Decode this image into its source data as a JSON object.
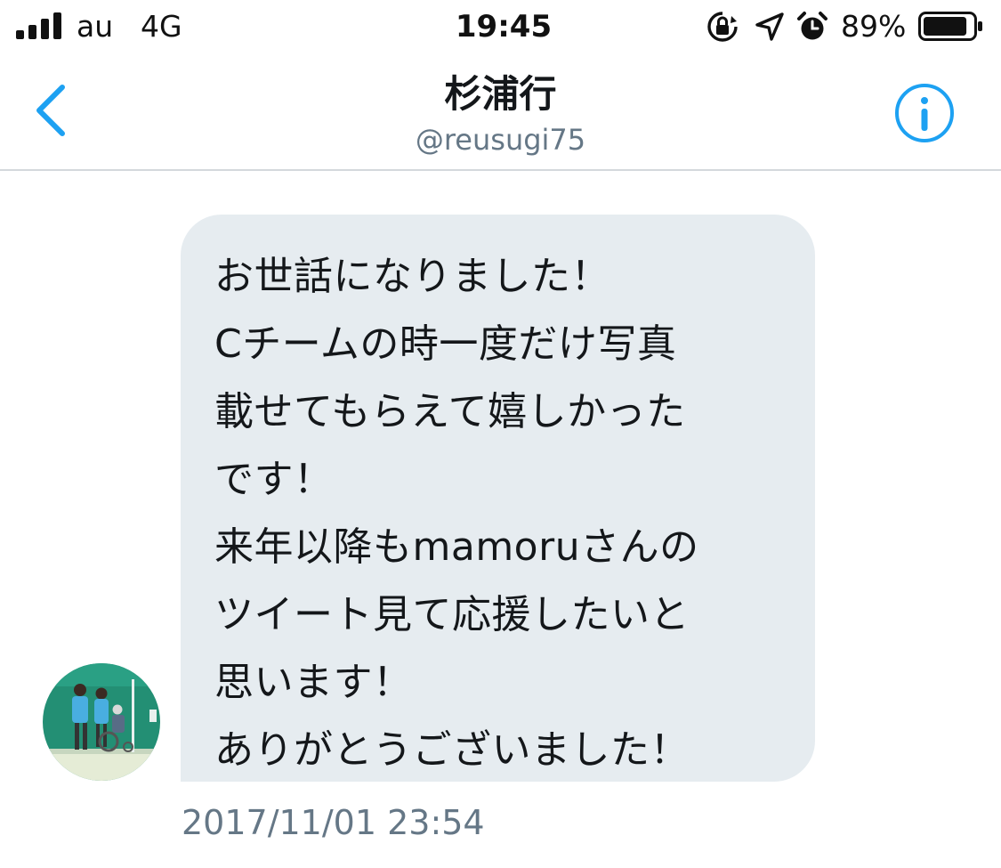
{
  "status_bar": {
    "carrier": "au",
    "network": "4G",
    "time": "19:45",
    "battery_percent": "89%",
    "battery_level": 0.89
  },
  "header": {
    "title": "杉浦行",
    "handle": "@reusugi75"
  },
  "message": {
    "lines": [
      "お世話になりました！",
      "Cチームの時一度だけ写真",
      "載せてもらえて嬉しかった",
      "です！",
      "来年以降もmamoruさんの",
      "ツイート見て応援したいと",
      "思います！",
      "ありがとうございました！"
    ],
    "timestamp": "2017/11/01 23:54"
  },
  "colors": {
    "accent": "#1da1f2",
    "bubble": "#e6ecf0",
    "secondary_text": "#657786",
    "divider": "#d4d8dc"
  },
  "icons": {
    "back": "chevron-left-icon",
    "info": "info-icon",
    "orientation_lock": "orientation-lock-icon",
    "location": "location-arrow-icon",
    "alarm": "alarm-clock-icon"
  }
}
